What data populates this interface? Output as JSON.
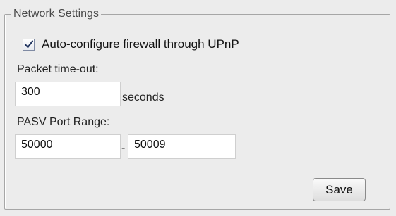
{
  "group": {
    "title": "Network Settings"
  },
  "upnp": {
    "label": "Auto-configure firewall through UPnP",
    "checked": true
  },
  "packet_timeout": {
    "label": "Packet time-out:",
    "value": "300",
    "unit": "seconds"
  },
  "pasv": {
    "label": "PASV Port Range:",
    "start_value": "50000",
    "separator": "-",
    "end_value": "50009"
  },
  "actions": {
    "save_label": "Save"
  },
  "colors": {
    "panel_background": "#ececec",
    "checkmark": "#22355f",
    "border": "#a6a6a6"
  },
  "icons": {
    "checkbox_check": "checkmark-icon"
  }
}
